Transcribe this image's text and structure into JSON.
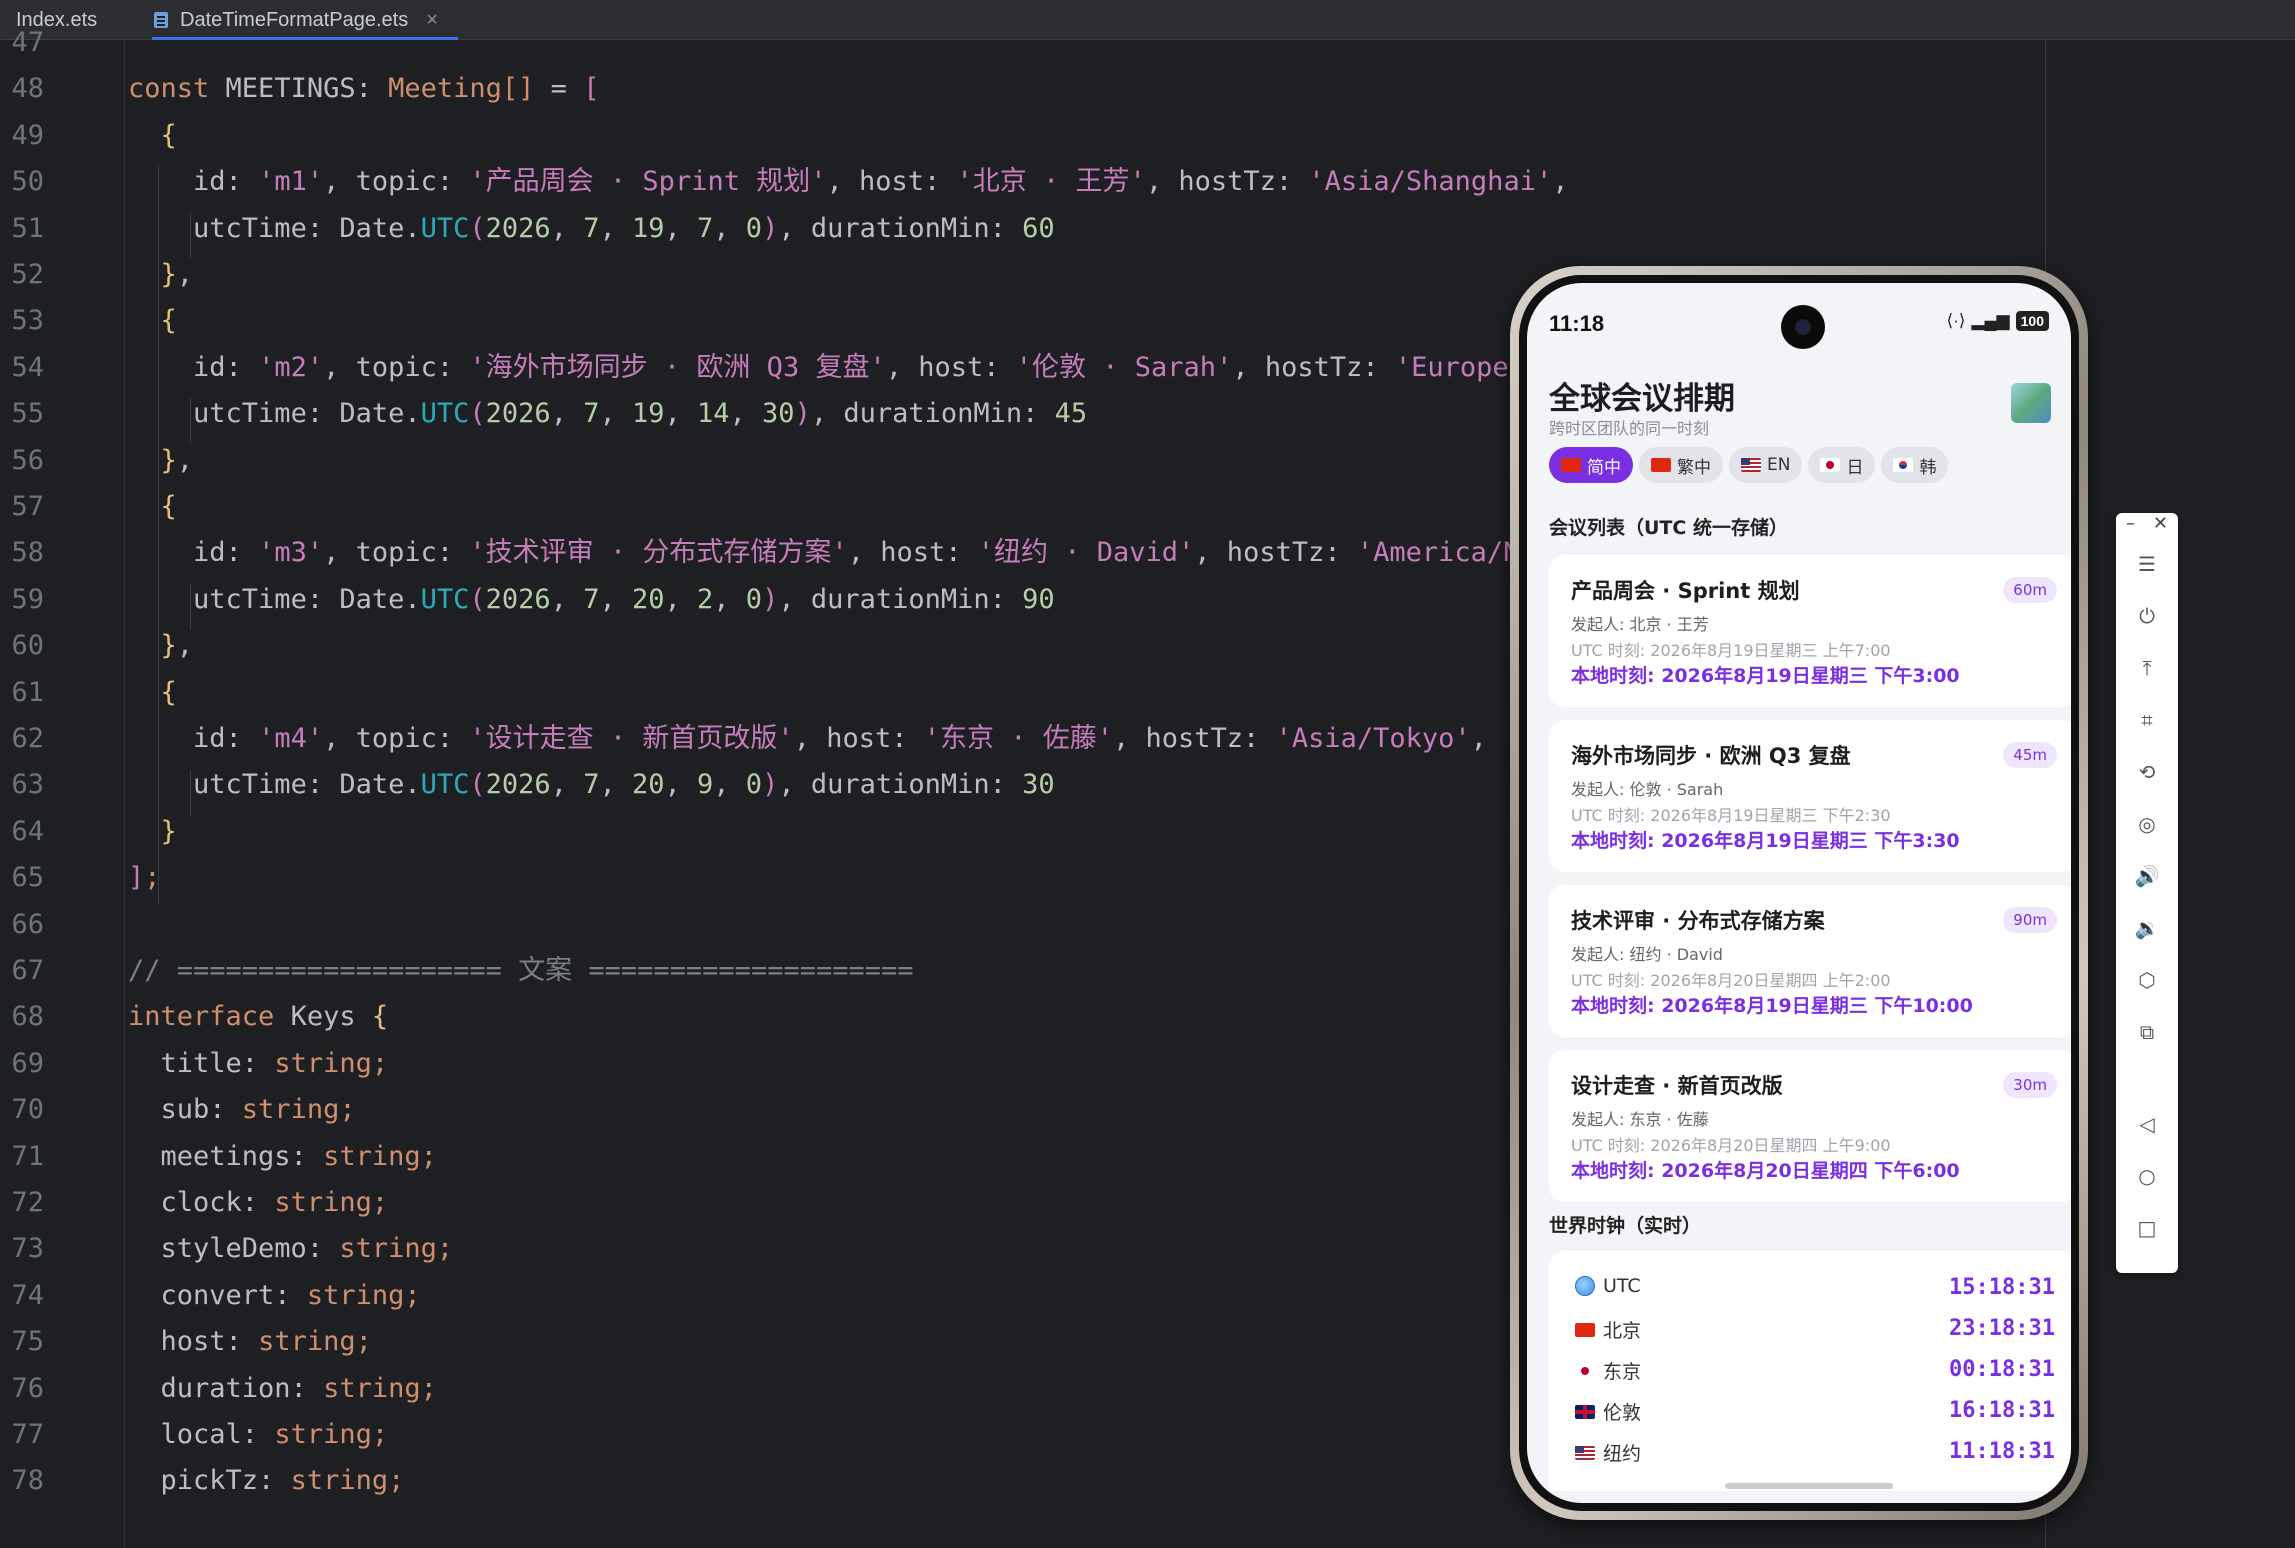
{
  "tabs": [
    {
      "name": "Index.ets",
      "active": false
    },
    {
      "name": "DateTimeFormatPage.ets",
      "active": true
    }
  ],
  "code_lines": [
    {
      "n": "47",
      "html": ""
    },
    {
      "n": "48",
      "html": "<span class=\"kw\">const</span> <span class=\"pun\">MEETINGS: </span><span class=\"ty\">Meeting[]</span><span class=\"pun\"> = </span><span class=\"st\">[</span>"
    },
    {
      "n": "49",
      "html": "  <span class=\"yl\">{</span>"
    },
    {
      "n": "50",
      "html": "    <span class=\"pun\">id: </span><span class=\"cj\">'m1'</span><span class=\"pun\">, topic: </span><span class=\"cj\">'产品周会 · Sprint 规划'</span><span class=\"pun\">, host: </span><span class=\"cj\">'北京 · 王芳'</span><span class=\"pun\">, hostTz: </span><span class=\"cj\">'Asia/Shanghai'</span><span class=\"pun\">,</span>"
    },
    {
      "n": "51",
      "html": "    <span class=\"pun\">utcTime: Date.</span><span class=\"nm\">UTC</span><span class=\"st\">(</span><span class=\"num\">2026</span><span class=\"pun\">, </span><span class=\"num\">7</span><span class=\"pun\">, </span><span class=\"num\">19</span><span class=\"pun\">, </span><span class=\"num\">7</span><span class=\"pun\">, </span><span class=\"num\">0</span><span class=\"st\">)</span><span class=\"pun\">, durationMin: </span><span class=\"num\">60</span>"
    },
    {
      "n": "52",
      "html": "  <span class=\"yl\">}</span><span class=\"pun\">,</span>"
    },
    {
      "n": "53",
      "html": "  <span class=\"yl\">{</span>"
    },
    {
      "n": "54",
      "html": "    <span class=\"pun\">id: </span><span class=\"cj\">'m2'</span><span class=\"pun\">, topic: </span><span class=\"cj\">'海外市场同步 · 欧洲 Q3 复盘'</span><span class=\"pun\">, host: </span><span class=\"cj\">'伦敦 · Sarah'</span><span class=\"pun\">, hostTz: </span><span class=\"cj\">'Europe/</span>"
    },
    {
      "n": "55",
      "html": "    <span class=\"pun\">utcTime: Date.</span><span class=\"nm\">UTC</span><span class=\"st\">(</span><span class=\"num\">2026</span><span class=\"pun\">, </span><span class=\"num\">7</span><span class=\"pun\">, </span><span class=\"num\">19</span><span class=\"pun\">, </span><span class=\"num\">14</span><span class=\"pun\">, </span><span class=\"num\">30</span><span class=\"st\">)</span><span class=\"pun\">, durationMin: </span><span class=\"num\">45</span>"
    },
    {
      "n": "56",
      "html": "  <span class=\"yl\">}</span><span class=\"pun\">,</span>"
    },
    {
      "n": "57",
      "html": "  <span class=\"yl\">{</span>"
    },
    {
      "n": "58",
      "html": "    <span class=\"pun\">id: </span><span class=\"cj\">'m3'</span><span class=\"pun\">, topic: </span><span class=\"cj\">'技术评审 · 分布式存储方案'</span><span class=\"pun\">, host: </span><span class=\"cj\">'纽约 · David'</span><span class=\"pun\">, hostTz: </span><span class=\"cj\">'America/Ne</span>"
    },
    {
      "n": "59",
      "html": "    <span class=\"pun\">utcTime: Date.</span><span class=\"nm\">UTC</span><span class=\"st\">(</span><span class=\"num\">2026</span><span class=\"pun\">, </span><span class=\"num\">7</span><span class=\"pun\">, </span><span class=\"num\">20</span><span class=\"pun\">, </span><span class=\"num\">2</span><span class=\"pun\">, </span><span class=\"num\">0</span><span class=\"st\">)</span><span class=\"pun\">, durationMin: </span><span class=\"num\">90</span>"
    },
    {
      "n": "60",
      "html": "  <span class=\"yl\">}</span><span class=\"pun\">,</span>"
    },
    {
      "n": "61",
      "html": "  <span class=\"yl\">{</span>"
    },
    {
      "n": "62",
      "html": "    <span class=\"pun\">id: </span><span class=\"cj\">'m4'</span><span class=\"pun\">, topic: </span><span class=\"cj\">'设计走查 · 新首页改版'</span><span class=\"pun\">, host: </span><span class=\"cj\">'东京 · 佐藤'</span><span class=\"pun\">, hostTz: </span><span class=\"cj\">'Asia/Tokyo'</span><span class=\"pun\">,</span>"
    },
    {
      "n": "63",
      "html": "    <span class=\"pun\">utcTime: Date.</span><span class=\"nm\">UTC</span><span class=\"st\">(</span><span class=\"num\">2026</span><span class=\"pun\">, </span><span class=\"num\">7</span><span class=\"pun\">, </span><span class=\"num\">20</span><span class=\"pun\">, </span><span class=\"num\">9</span><span class=\"pun\">, </span><span class=\"num\">0</span><span class=\"st\">)</span><span class=\"pun\">, durationMin: </span><span class=\"num\">30</span>"
    },
    {
      "n": "64",
      "html": "  <span class=\"yl\">}</span>"
    },
    {
      "n": "65",
      "html": "<span class=\"st\">]</span><span class=\"kw\">;</span>"
    },
    {
      "n": "66",
      "html": ""
    },
    {
      "n": "67",
      "html": "<span class=\"cm\">// ==================== 文案 ====================</span>"
    },
    {
      "n": "68",
      "html": "<span class=\"kw\">interface</span> <span class=\"pun\">Keys </span><span class=\"yl\">{</span>"
    },
    {
      "n": "69",
      "html": "  <span class=\"pun\">title: </span><span class=\"ty\">string</span><span class=\"kw\">;</span>"
    },
    {
      "n": "70",
      "html": "  <span class=\"pun\">sub: </span><span class=\"ty\">string</span><span class=\"kw\">;</span>"
    },
    {
      "n": "71",
      "html": "  <span class=\"pun\">meetings: </span><span class=\"ty\">string</span><span class=\"kw\">;</span>"
    },
    {
      "n": "72",
      "html": "  <span class=\"pun\">clock: </span><span class=\"ty\">string</span><span class=\"kw\">;</span>"
    },
    {
      "n": "73",
      "html": "  <span class=\"pun\">styleDemo: </span><span class=\"ty\">string</span><span class=\"kw\">;</span>"
    },
    {
      "n": "74",
      "html": "  <span class=\"pun\">convert: </span><span class=\"ty\">string</span><span class=\"kw\">;</span>"
    },
    {
      "n": "75",
      "html": "  <span class=\"pun\">host: </span><span class=\"ty\">string</span><span class=\"kw\">;</span>"
    },
    {
      "n": "76",
      "html": "  <span class=\"pun\">duration: </span><span class=\"ty\">string</span><span class=\"kw\">;</span>"
    },
    {
      "n": "77",
      "html": "  <span class=\"pun\">local: </span><span class=\"ty\">string</span><span class=\"kw\">;</span>"
    },
    {
      "n": "78",
      "html": "  <span class=\"pun\">pickTz: </span><span class=\"ty\">string</span><span class=\"kw\">;</span>"
    }
  ],
  "phone": {
    "status_time": "11:18",
    "battery": "100",
    "title": "全球会议排期",
    "subtitle": "跨时区团队的同一时刻",
    "languages": [
      {
        "label": "简中",
        "flag": "cn",
        "active": true
      },
      {
        "label": "繁中",
        "flag": "hk",
        "active": false
      },
      {
        "label": "EN",
        "flag": "us",
        "active": false
      },
      {
        "label": "日",
        "flag": "jp",
        "active": false
      },
      {
        "label": "韩",
        "flag": "kr",
        "active": false
      }
    ],
    "meetings_title": "会议列表（UTC 统一存储）",
    "meetings": [
      {
        "topic": "产品周会 · Sprint 规划",
        "badge": "60m",
        "host": "发起人: 北京 · 王芳",
        "utc": "UTC 时刻: 2026年8月19日星期三 上午7:00",
        "local": "本地时刻: 2026年8月19日星期三 下午3:00"
      },
      {
        "topic": "海外市场同步 · 欧洲 Q3 复盘",
        "badge": "45m",
        "host": "发起人: 伦敦 · Sarah",
        "utc": "UTC 时刻: 2026年8月19日星期三 下午2:30",
        "local": "本地时刻: 2026年8月19日星期三 下午3:30"
      },
      {
        "topic": "技术评审 · 分布式存储方案",
        "badge": "90m",
        "host": "发起人: 纽约 · David",
        "utc": "UTC 时刻: 2026年8月20日星期四 上午2:00",
        "local": "本地时刻: 2026年8月19日星期三 下午10:00"
      },
      {
        "topic": "设计走查 · 新首页改版",
        "badge": "30m",
        "host": "发起人: 东京 · 佐藤",
        "utc": "UTC 时刻: 2026年8月20日星期四 上午9:00",
        "local": "本地时刻: 2026年8月20日星期四 下午6:00"
      }
    ],
    "clock_title": "世界时钟（实时）",
    "clocks": [
      {
        "label": "UTC",
        "flag": "globe",
        "time": "15:18:31"
      },
      {
        "label": "北京",
        "flag": "cn",
        "time": "23:18:31"
      },
      {
        "label": "东京",
        "flag": "jp",
        "time": "00:18:31"
      },
      {
        "label": "伦敦",
        "flag": "gb",
        "time": "16:18:31"
      },
      {
        "label": "纽约",
        "flag": "us",
        "time": "11:18:31"
      }
    ]
  },
  "toolbar": {
    "minimize": "–",
    "close": "✕",
    "buttons": [
      {
        "name": "menu-icon",
        "glyph": "☰"
      },
      {
        "name": "power-icon",
        "glyph": "⏻"
      },
      {
        "name": "pin-top-icon",
        "glyph": "⤒"
      },
      {
        "name": "crop-icon",
        "glyph": "⌗"
      },
      {
        "name": "rotate-icon",
        "glyph": "⟲"
      },
      {
        "name": "location-icon",
        "glyph": "◎"
      },
      {
        "name": "volume-up-icon",
        "glyph": "🔊"
      },
      {
        "name": "volume-down-icon",
        "glyph": "🔉"
      },
      {
        "name": "screenshot-icon",
        "glyph": "⬡"
      },
      {
        "name": "multiscreen-icon",
        "glyph": "⧉"
      },
      {
        "name": "back-icon",
        "glyph": "◁"
      },
      {
        "name": "home-icon",
        "glyph": "○"
      },
      {
        "name": "recents-icon",
        "glyph": "□"
      }
    ]
  }
}
